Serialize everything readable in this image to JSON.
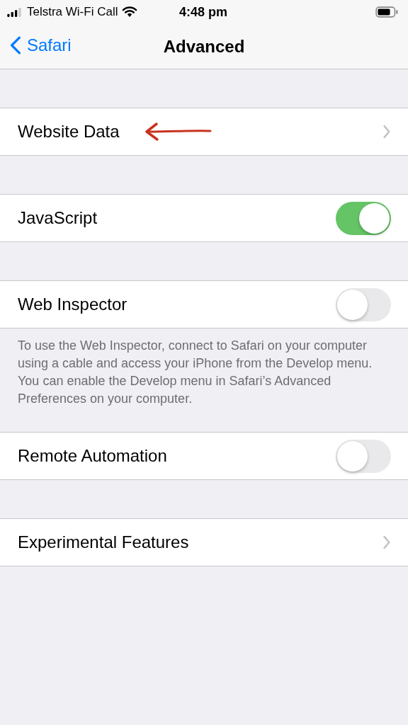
{
  "status_bar": {
    "carrier": "Telstra Wi-Fi Call",
    "time": "4:48 pm"
  },
  "nav_bar": {
    "back_label": "Safari",
    "title": "Advanced"
  },
  "groups": [
    {
      "rows": [
        {
          "kind": "link",
          "label": "Website Data",
          "annotated": true
        }
      ]
    },
    {
      "rows": [
        {
          "kind": "toggle",
          "label": "JavaScript",
          "on": true
        }
      ]
    },
    {
      "rows": [
        {
          "kind": "toggle",
          "label": "Web Inspector",
          "on": false
        }
      ],
      "footer": "To use the Web Inspector, connect to Safari on your computer using a cable and access your iPhone from the Develop menu. You can enable the Develop menu in Safari’s Advanced Preferences on your computer."
    },
    {
      "rows": [
        {
          "kind": "toggle",
          "label": "Remote Automation",
          "on": false
        }
      ]
    },
    {
      "rows": [
        {
          "kind": "link",
          "label": "Experimental Features",
          "annotated": false
        }
      ]
    }
  ]
}
